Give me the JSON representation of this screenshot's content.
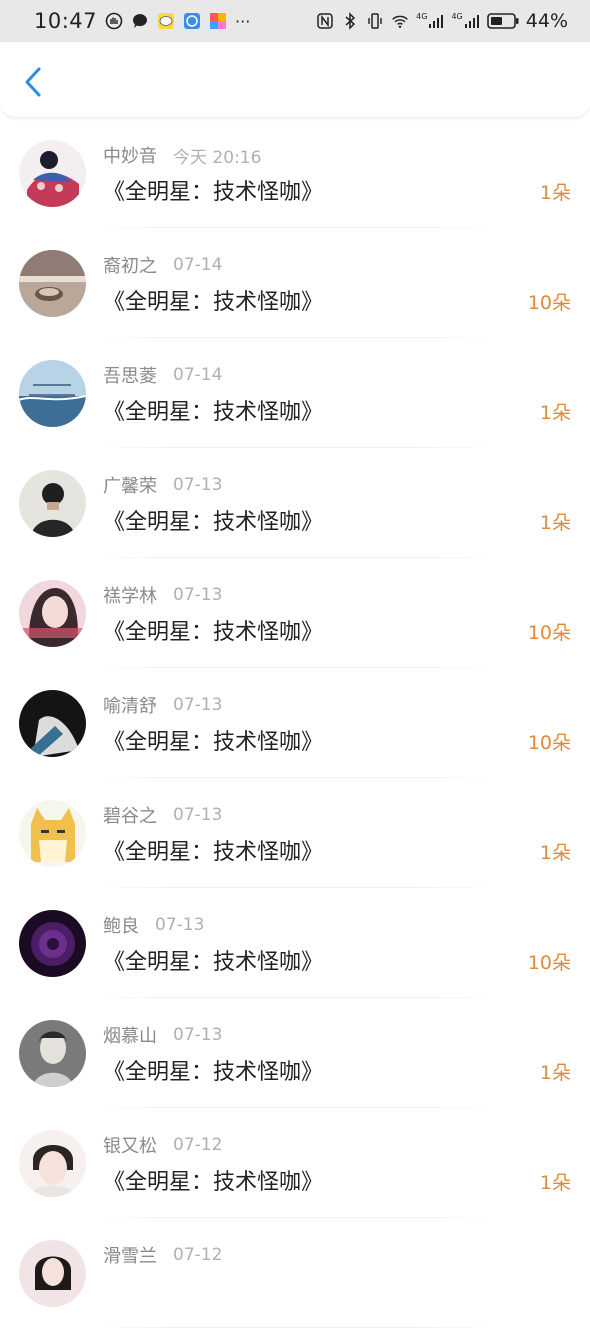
{
  "status_bar": {
    "time": "10:47",
    "more": "···",
    "battery": "44%",
    "net1": "4G",
    "net2": "4G"
  },
  "nav": {
    "back_icon": "chevron-left-icon"
  },
  "colors": {
    "accent_blue": "#2a8ce8",
    "count_orange": "#e08a3c"
  },
  "items": [
    {
      "name": "中妙音",
      "time": "今天 20:16",
      "title": "《全明星：技术怪咖》",
      "count": "1朵"
    },
    {
      "name": "裔初之",
      "time": "07-14",
      "title": "《全明星：技术怪咖》",
      "count": "10朵"
    },
    {
      "name": "吾思菱",
      "time": "07-14",
      "title": "《全明星：技术怪咖》",
      "count": "1朵"
    },
    {
      "name": "广馨荣",
      "time": "07-13",
      "title": "《全明星：技术怪咖》",
      "count": "1朵"
    },
    {
      "name": "禚学林",
      "time": "07-13",
      "title": "《全明星：技术怪咖》",
      "count": "10朵"
    },
    {
      "name": "喻清舒",
      "time": "07-13",
      "title": "《全明星：技术怪咖》",
      "count": "10朵"
    },
    {
      "name": "碧谷之",
      "time": "07-13",
      "title": "《全明星：技术怪咖》",
      "count": "1朵"
    },
    {
      "name": "鲍良",
      "time": "07-13",
      "title": "《全明星：技术怪咖》",
      "count": "10朵"
    },
    {
      "name": "烟慕山",
      "time": "07-13",
      "title": "《全明星：技术怪咖》",
      "count": "1朵"
    },
    {
      "name": "银又松",
      "time": "07-12",
      "title": "《全明星：技术怪咖》",
      "count": "1朵"
    },
    {
      "name": "滑雪兰",
      "time": "07-12",
      "title": "",
      "count": ""
    }
  ]
}
